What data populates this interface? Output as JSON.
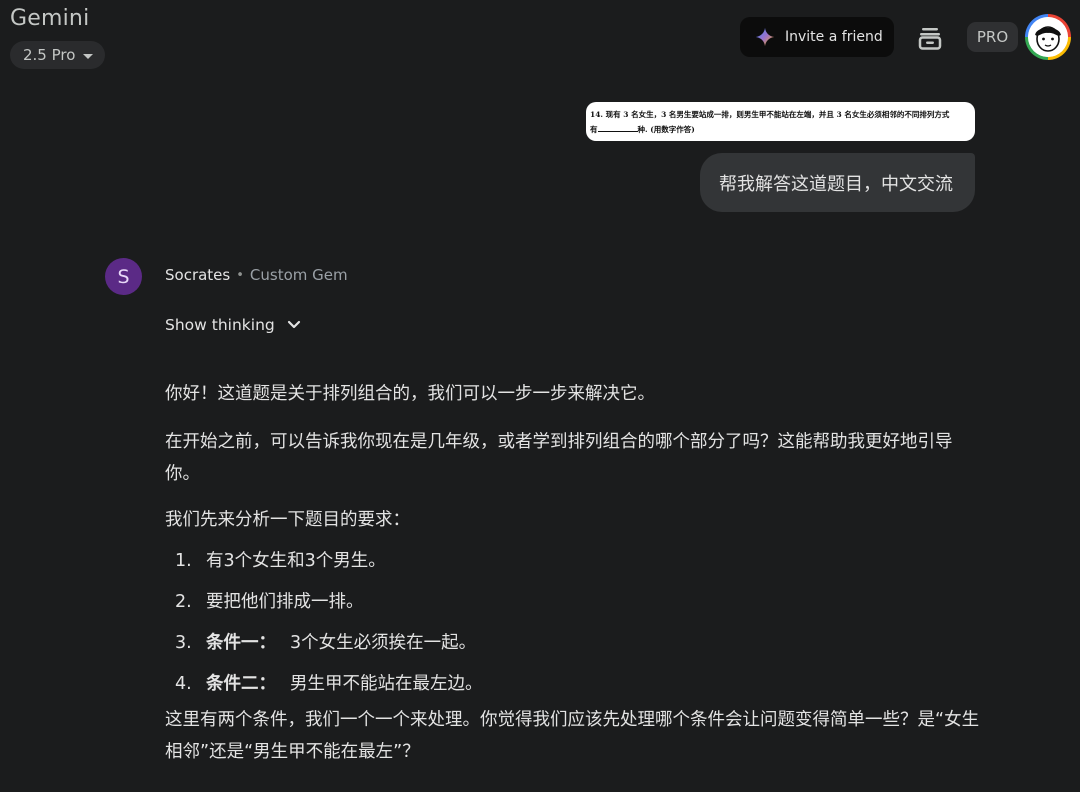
{
  "header": {
    "app_title": "Gemini",
    "model": "2.5 Pro",
    "invite_label": "Invite a friend",
    "pro_badge": "PRO"
  },
  "user_message": {
    "image_text_line1": "14. 现有 3 名女生，3 名男生要站成一排，则男生甲不能站在左端，并且 3 名女生必须相邻的不同排列方式",
    "image_text_line2_prefix": "有",
    "image_text_line2_suffix": "种. (用数字作答)",
    "text": "帮我解答这道题目，中文交流"
  },
  "bot": {
    "avatar_letter": "S",
    "name": "Socrates",
    "separator": "•",
    "kind": "Custom Gem",
    "show_thinking": "Show thinking",
    "paragraph1": "你好！这道题是关于排列组合的，我们可以一步一步来解决它。",
    "paragraph2": "在开始之前，可以告诉我你现在是几年级，或者学到排列组合的哪个部分了吗？这能帮助我更好地引导你。",
    "paragraph3": "我们先来分析一下题目的要求：",
    "requirements": [
      {
        "num": "1.",
        "bold": "",
        "text": "有3个女生和3个男生。"
      },
      {
        "num": "2.",
        "bold": "",
        "text": "要把他们排成一排。"
      },
      {
        "num": "3.",
        "bold": "条件一：",
        "text": "3个女生必须挨在一起。"
      },
      {
        "num": "4.",
        "bold": "条件二：",
        "text": "男生甲不能站在最左边。"
      }
    ],
    "paragraph4": "这里有两个条件，我们一个一个来处理。你觉得我们应该先处理哪个条件会让问题变得简单一些？是“女生相邻”还是“男生甲不能在最左”？"
  },
  "icons": [
    "sparkle-icon",
    "chevron-down-icon",
    "stack-icon",
    "avatar-icon"
  ]
}
